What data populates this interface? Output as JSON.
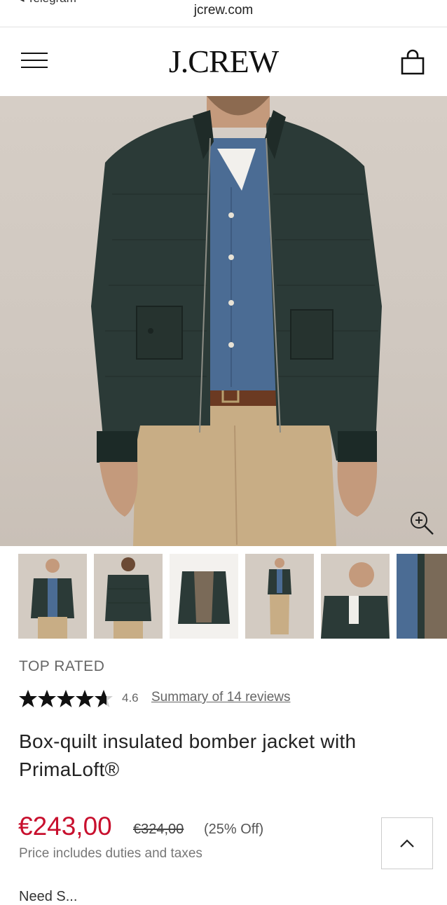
{
  "browser": {
    "back_app": "◂ Telegram",
    "url": "jcrew.com"
  },
  "header": {
    "logo": "J.CREW"
  },
  "product": {
    "badge": "TOP RATED",
    "rating": "4.6",
    "stars": 4.6,
    "reviews_link": "Summary of 14 reviews",
    "title": "Box-quilt insulated bomber jacket with PrimaLoft®",
    "price_sale": "€243,00",
    "price_original": "€324,00",
    "price_discount": "(25% Off)",
    "price_note": "Price includes duties and taxes",
    "next_section_partial": "Need S..."
  },
  "colors": {
    "sale_red": "#c8102e",
    "jacket_green": "#2b3a37",
    "denim": "#4b6c94",
    "khaki": "#c8ad85"
  }
}
